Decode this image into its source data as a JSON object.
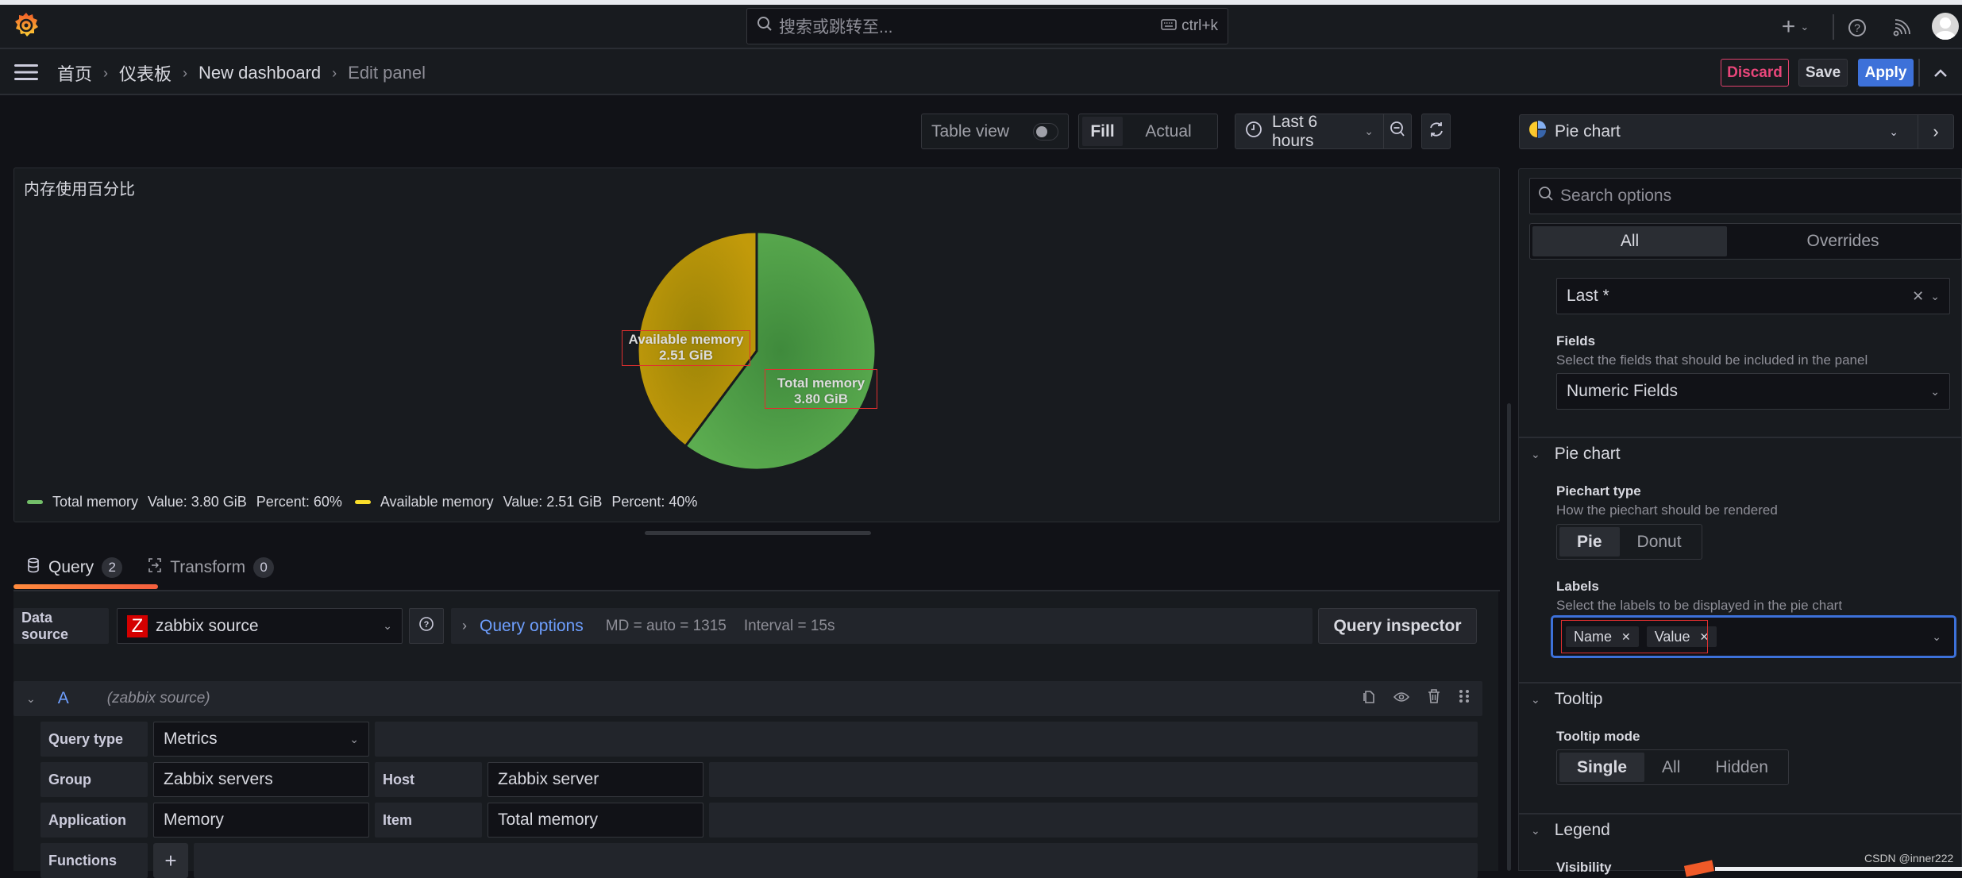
{
  "topbar": {
    "search_placeholder": "搜索或跳转至...",
    "search_shortcut": "ctrl+k",
    "icons": [
      "grafana-logo-icon",
      "search-icon",
      "keyboard-icon",
      "plus-icon",
      "chevron-down-icon",
      "help-icon",
      "news-feed-icon",
      "user-avatar-icon"
    ]
  },
  "breadcrumb": {
    "items": [
      "首页",
      "仪表板",
      "New dashboard",
      "Edit panel"
    ]
  },
  "actions": {
    "discard": "Discard",
    "save": "Save",
    "apply": "Apply"
  },
  "panel_toolbar": {
    "table_view": "Table view",
    "table_view_on": false,
    "fill": "Fill",
    "actual": "Actual",
    "fill_selected": "Fill",
    "time_range": "Last 6 hours"
  },
  "panel": {
    "title": "内存使用百分比"
  },
  "chart_data": {
    "type": "pie",
    "title": "内存使用百分比",
    "unit": "GiB",
    "labels_shown": [
      "Name",
      "Value"
    ],
    "legend_placement": "bottom-left",
    "series": [
      {
        "name": "Total memory",
        "value": 3.8,
        "value_text": "3.80 GiB",
        "percent": 60,
        "color": "#56a64b"
      },
      {
        "name": "Available memory",
        "value": 2.51,
        "value_text": "2.51 GiB",
        "percent": 40,
        "color": "#e0b400"
      }
    ],
    "legend": [
      {
        "name": "Total memory",
        "value_label": "Value: 3.80 GiB",
        "percent_label": "Percent: 60%"
      },
      {
        "name": "Available memory",
        "value_label": "Value: 2.51 GiB",
        "percent_label": "Percent: 40%"
      }
    ]
  },
  "editor_tabs": [
    {
      "label": "Query",
      "count": "2",
      "active": true
    },
    {
      "label": "Transform",
      "count": "0",
      "active": false
    }
  ],
  "query": {
    "data_source_label": "Data source",
    "data_source_value": "zabbix source",
    "data_source_icon_letter": "Z",
    "query_options_label": "Query options",
    "md": "MD = auto = 1315",
    "interval": "Interval = 15s",
    "inspector": "Query inspector",
    "row": {
      "ref_id": "A",
      "source": "(zabbix source)"
    },
    "fields": {
      "query_type_label": "Query type",
      "query_type_value": "Metrics",
      "group_label": "Group",
      "group_value": "Zabbix servers",
      "host_label": "Host",
      "host_value": "Zabbix server",
      "application_label": "Application",
      "application_value": "Memory",
      "item_label": "Item",
      "item_value": "Total memory",
      "functions_label": "Functions",
      "functions_add": "+"
    }
  },
  "options": {
    "viz_name": "Pie chart",
    "search_placeholder": "Search options",
    "tabs": [
      "All",
      "Overrides"
    ],
    "active_tab": "All",
    "calc_value": "Last *",
    "fields_label": "Fields",
    "fields_desc": "Select the fields that should be included in the panel",
    "fields_value": "Numeric Fields",
    "piechart_section": "Pie chart",
    "piechart_type_label": "Piechart type",
    "piechart_type_desc": "How the piechart should be rendered",
    "piechart_type_options": [
      "Pie",
      "Donut"
    ],
    "piechart_type_selected": "Pie",
    "labels_label": "Labels",
    "labels_desc": "Select the labels to be displayed in the pie chart",
    "labels_values": [
      "Name",
      "Value"
    ],
    "tooltip_section": "Tooltip",
    "tooltip_mode_label": "Tooltip mode",
    "tooltip_mode_options": [
      "Single",
      "All",
      "Hidden"
    ],
    "tooltip_mode_selected": "Single",
    "legend_section": "Legend",
    "visibility_label": "Visibility"
  },
  "watermark": "CSDN @inner222"
}
